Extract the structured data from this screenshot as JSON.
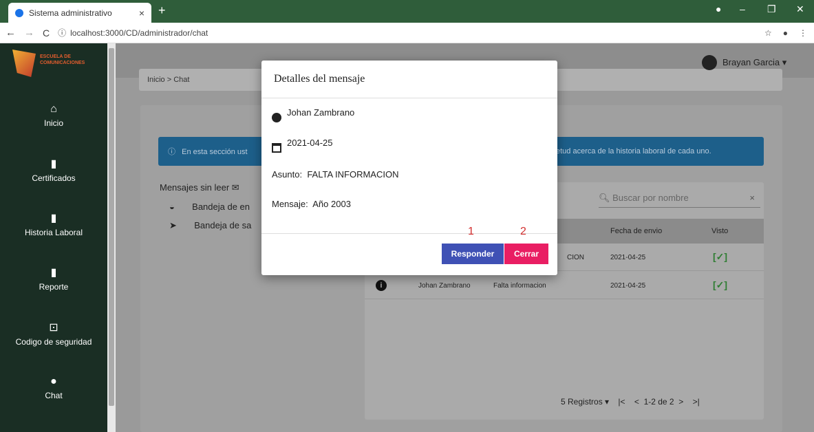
{
  "browser": {
    "tab_title": "Sistema administrativo",
    "tab_close": "×",
    "new_tab": "+",
    "url": "localhost:3000/CD/administrador/chat",
    "nav_back": "←",
    "nav_forward": "→",
    "reload": "C",
    "info": "ⓘ"
  },
  "app": {
    "logo_text_1": "ESCUELA DE",
    "logo_text_2": "COMUNICACIONES",
    "user_name": "Brayan Garcia ▾",
    "breadcrumb": "Inicio > Chat"
  },
  "sidebar": {
    "items": [
      {
        "label": "Inicio",
        "icon": "home-icon"
      },
      {
        "label": "Certificados",
        "icon": "book-icon"
      },
      {
        "label": "Historia Laboral",
        "icon": "bookmark-icon"
      },
      {
        "label": "Reporte",
        "icon": "report-icon"
      },
      {
        "label": "Codigo de seguridad",
        "icon": "lock-icon"
      },
      {
        "label": "Chat",
        "icon": "chat-icon"
      }
    ]
  },
  "alert": {
    "text_left": "En esta sección ust",
    "text_right": "etud acerca de la historia laboral de cada uno."
  },
  "messages_panel": {
    "unread_label": "Mensajes sin leer",
    "inbox": "Bandeja de en",
    "outbox": "Bandeja de sa"
  },
  "table": {
    "search_placeholder": "Buscar por nombre",
    "search_clear": "×",
    "headers": [
      "Fecha de envio",
      "Visto"
    ],
    "rows": [
      {
        "name": "",
        "subject": "CION",
        "date": "2021-04-25",
        "seen": "✓"
      },
      {
        "name": "Johan Zambrano",
        "subject": "Falta informacion",
        "date": "2021-04-25",
        "seen": "✓"
      }
    ],
    "pagination": {
      "per_page": "5 Registros",
      "first": "|<",
      "prev": "<",
      "range": "1-2 de 2",
      "next": ">",
      "last": ">|"
    }
  },
  "modal": {
    "title": "Detalles del mensaje",
    "sender": "Johan Zambrano",
    "date": "2021-04-25",
    "subject_label": "Asunto:",
    "subject": "FALTA INFORMACION",
    "message_label": "Mensaje:",
    "message": "Año 2003",
    "reply_button": "Responder",
    "close_button": "Cerrar",
    "marker_1": "1",
    "marker_2": "2"
  },
  "colors": {
    "reply": "#3f51b5",
    "close": "#e91e63",
    "titlebar": "#2f5d3a",
    "sidebar": "#1a2e24"
  }
}
